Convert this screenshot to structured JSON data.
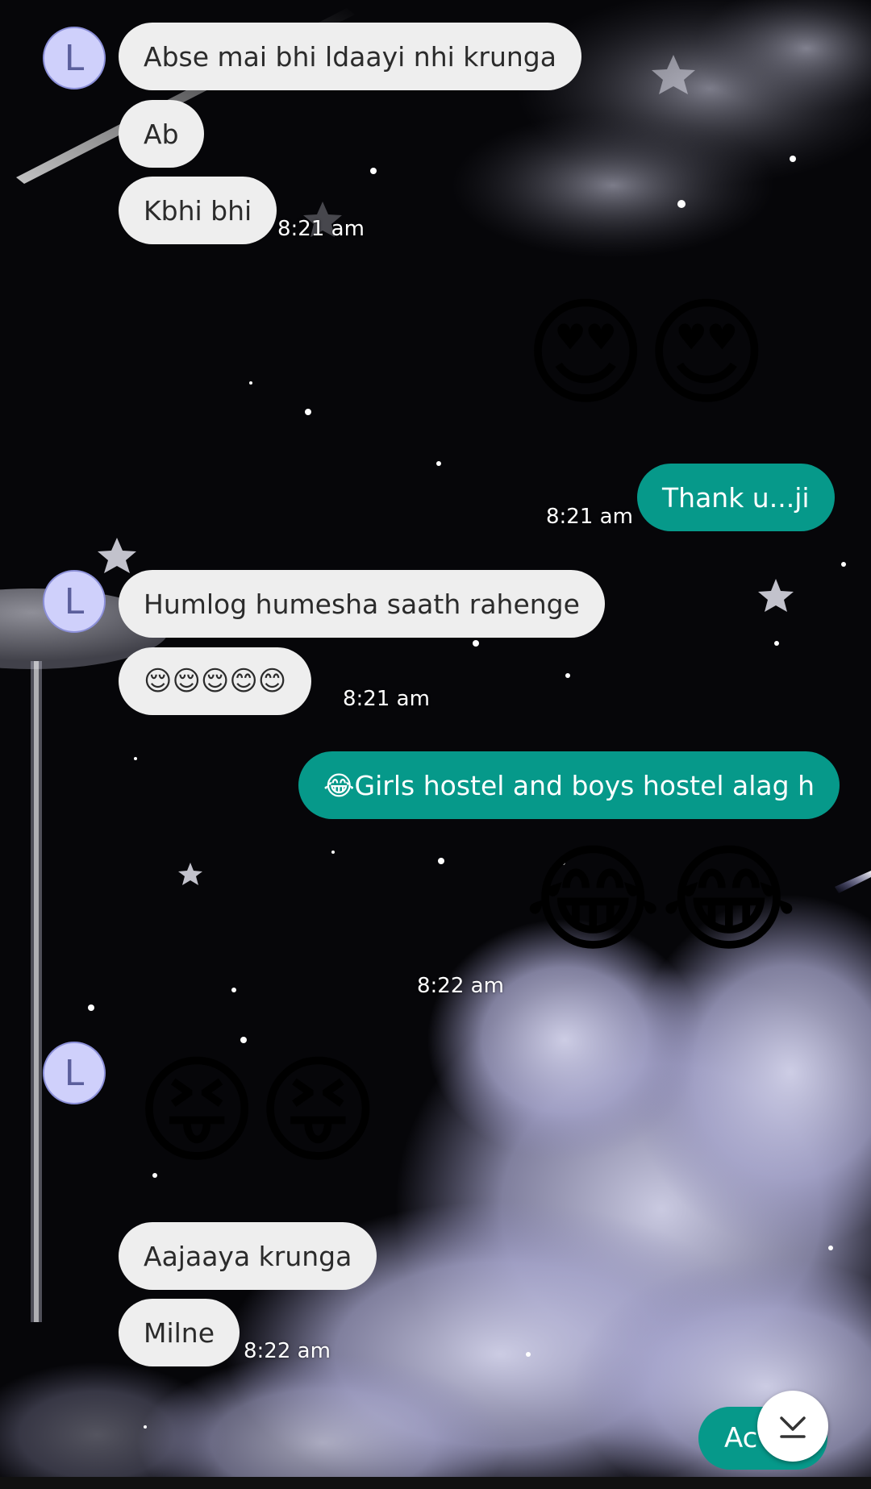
{
  "avatar_letter": "L",
  "colors": {
    "incoming_bubble": "#eeeeee",
    "outgoing_bubble": "#06998a",
    "avatar_bg": "#cfd0fb"
  },
  "messages": {
    "m1": "Abse mai bhi ldaayi nhi krunga",
    "m2": "Ab",
    "m3": "Kbhi bhi",
    "t1": "8:21 am",
    "e1": "😍😍",
    "m4": "Thank u...ji",
    "t2": "8:21 am",
    "m5": "Humlog humesha saath rahenge",
    "m6": "😌😌😌😊😊",
    "t3": "8:21 am",
    "m7": "😂Girls hostel and boys hostel alag h",
    "e2": "😂😂",
    "t4": "8:22 am",
    "e3": "😝😝",
    "m8": "Aajaaya krunga",
    "m9": "Milne",
    "t5": "8:22 am"
  },
  "compose_pill_label": "Ac",
  "icons": {
    "scroll_down": "chevron-down-to-line-icon"
  }
}
